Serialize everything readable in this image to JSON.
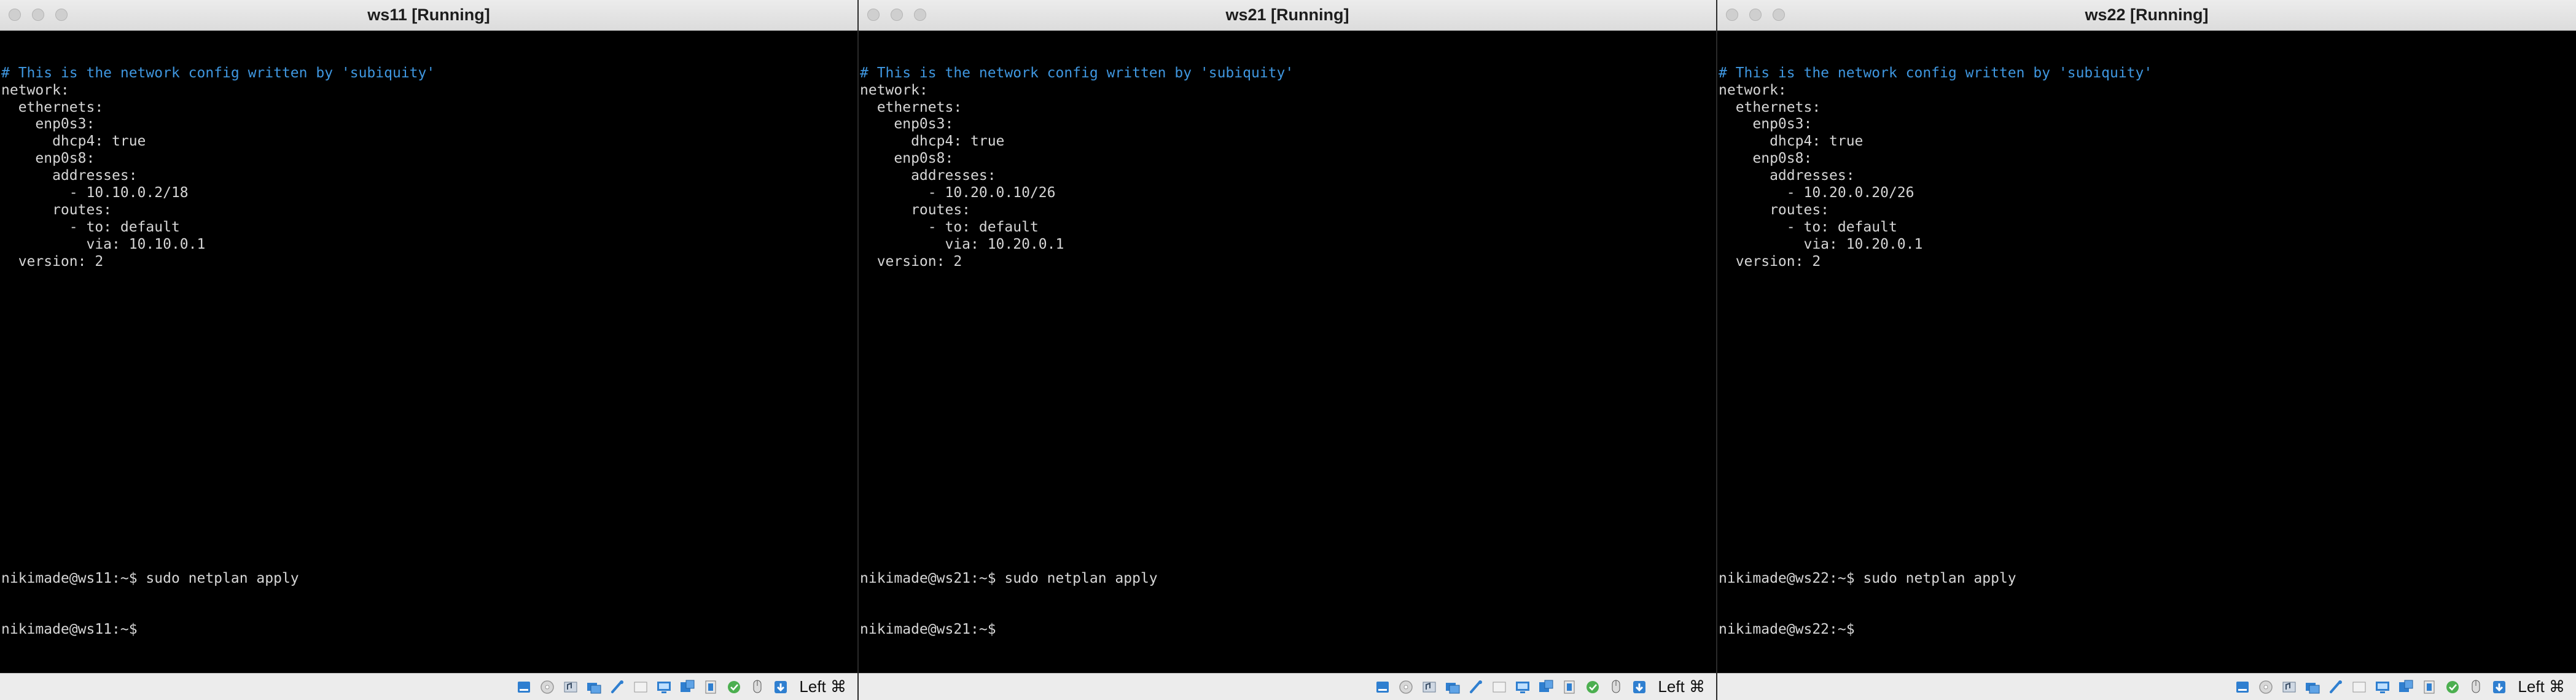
{
  "windows": [
    {
      "title": "ws11 [Running]",
      "config_lines": [
        {
          "text": "# This is the network config written by 'subiquity'",
          "comment": true
        },
        {
          "text": "network:",
          "comment": false
        },
        {
          "text": "  ethernets:",
          "comment": false
        },
        {
          "text": "    enp0s3:",
          "comment": false
        },
        {
          "text": "      dhcp4: true",
          "comment": false
        },
        {
          "text": "    enp0s8:",
          "comment": false
        },
        {
          "text": "      addresses:",
          "comment": false
        },
        {
          "text": "        - 10.10.0.2/18",
          "comment": false
        },
        {
          "text": "      routes:",
          "comment": false
        },
        {
          "text": "        - to: default",
          "comment": false
        },
        {
          "text": "          via: 10.10.0.1",
          "comment": false
        },
        {
          "text": "  version: 2",
          "comment": false
        }
      ],
      "prompt_lines": [
        "nikimade@ws11:~$ sudo netplan apply",
        "nikimade@ws11:~$"
      ],
      "host_key": "Left ⌘"
    },
    {
      "title": "ws21 [Running]",
      "config_lines": [
        {
          "text": "# This is the network config written by 'subiquity'",
          "comment": true
        },
        {
          "text": "network:",
          "comment": false
        },
        {
          "text": "  ethernets:",
          "comment": false
        },
        {
          "text": "    enp0s3:",
          "comment": false
        },
        {
          "text": "      dhcp4: true",
          "comment": false
        },
        {
          "text": "    enp0s8:",
          "comment": false
        },
        {
          "text": "      addresses:",
          "comment": false
        },
        {
          "text": "        - 10.20.0.10/26",
          "comment": false
        },
        {
          "text": "      routes:",
          "comment": false
        },
        {
          "text": "        - to: default",
          "comment": false
        },
        {
          "text": "          via: 10.20.0.1",
          "comment": false
        },
        {
          "text": "  version: 2",
          "comment": false
        }
      ],
      "prompt_lines": [
        "nikimade@ws21:~$ sudo netplan apply",
        "nikimade@ws21:~$"
      ],
      "host_key": "Left ⌘"
    },
    {
      "title": "ws22 [Running]",
      "config_lines": [
        {
          "text": "# This is the network config written by 'subiquity'",
          "comment": true
        },
        {
          "text": "network:",
          "comment": false
        },
        {
          "text": "  ethernets:",
          "comment": false
        },
        {
          "text": "    enp0s3:",
          "comment": false
        },
        {
          "text": "      dhcp4: true",
          "comment": false
        },
        {
          "text": "    enp0s8:",
          "comment": false
        },
        {
          "text": "      addresses:",
          "comment": false
        },
        {
          "text": "        - 10.20.0.20/26",
          "comment": false
        },
        {
          "text": "      routes:",
          "comment": false
        },
        {
          "text": "        - to: default",
          "comment": false
        },
        {
          "text": "          via: 10.20.0.1",
          "comment": false
        },
        {
          "text": "  version: 2",
          "comment": false
        }
      ],
      "prompt_lines": [
        "nikimade@ws22:~$ sudo netplan apply",
        "nikimade@ws22:~$"
      ],
      "host_key": "Left ⌘"
    }
  ],
  "status_icons": [
    "hard-disk-icon",
    "optical-drive-icon",
    "audio-icon",
    "network-icon",
    "usb-icon",
    "shared-folders-icon",
    "display-icon",
    "video-capture-icon",
    "recording-icon",
    "cpu-icon",
    "mouse-integration-icon",
    "keyboard-capture-icon"
  ],
  "colors": {
    "terminal_bg": "#000000",
    "terminal_fg": "#d6d6d6",
    "comment": "#3f97e0",
    "status_icon_blue": "#2f7fd0"
  }
}
